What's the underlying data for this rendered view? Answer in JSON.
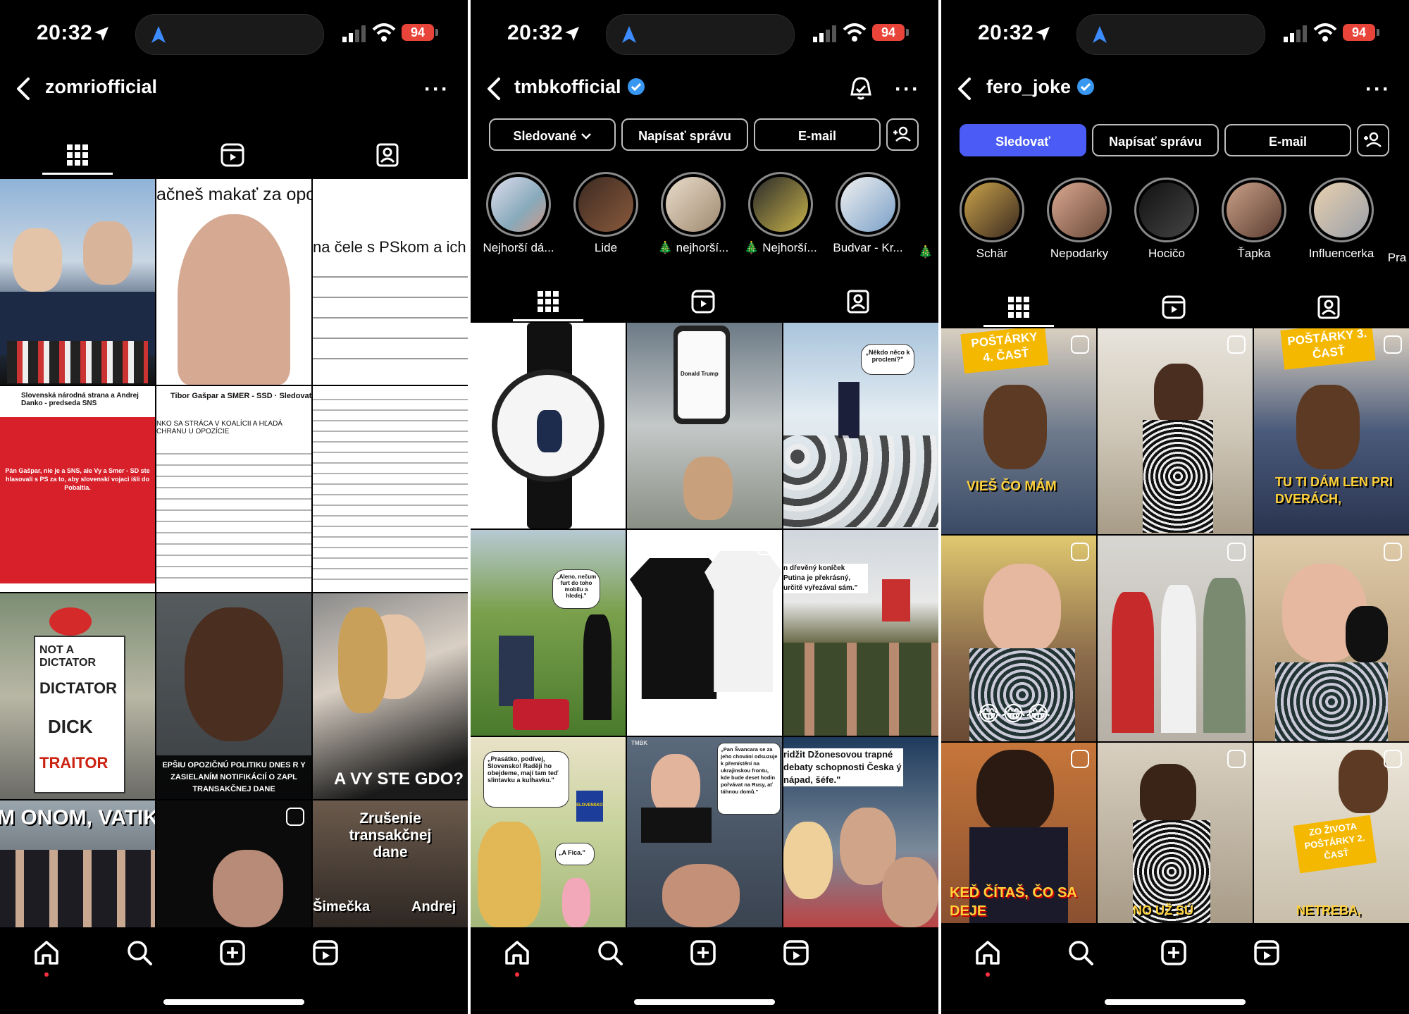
{
  "status": {
    "time": "20:32",
    "battery": "94"
  },
  "phones": [
    {
      "username": "zomriofficial",
      "verified": false,
      "grid_texts": [
        "ačneš makať za opo",
        "na čele s PSkom a ich",
        "Slovenská národná strana a Andrej Danko - predseda SNS",
        "Pán Gašpar, nie je a SNS, ale Vy a Smer - SD ste hlasovali s PS za to, aby slovenskí vojaci išli do Pobaltia.",
        "Tibor Gašpar a SMER - SSD · Sledovať",
        "NKO SA STRÁCA V KOALÍCII A HĽADÁ CHRANU U OPOZÍCIE",
        "NOT A DICTATOR",
        "DICTATOR",
        "DICK",
        "TRAITOR",
        "EPŠIU OPOZIČNÚ POLITIKU DNES R Y ZASIELANÍM NOTIFIKÁCIÍ O ZAPL TRANSAKČNEJ DANE",
        "A VY STE GDO?",
        "M ONOM, VATIK",
        "Zrušenie transakčnej dane",
        "Šimečka",
        "Andrej"
      ]
    },
    {
      "username": "tmbkofficial",
      "verified": true,
      "buttons": [
        "Sledované",
        "Napísať správu",
        "E-mail"
      ],
      "stories": [
        "Nejhorší dá...",
        "Lide",
        "🎄 nejhorší...",
        "🎄 Nejhorší...",
        "Budvar - Kr...",
        "🎄"
      ],
      "grid_texts": [
        "„Někdo něco k proclení?\"",
        "Donald Trump",
        "„Aleno, nečum furt do toho mobilu a hledej.\"",
        "n dřevěný koníček Putina je překrásný, určitě vyřezával sám.\"",
        "„Prasátko, podívej, Slovensko! Raději ho obejdeme, mají tam teď slintavku a kulhavku.\"",
        "„A Fica.\"",
        "„Pan Švancara se za jeho chování odsuzuje k přemístění na ukrajinskou frontu, kde bude deset hodin pořvávat na Rusy, ať táhnou domů.\"",
        "ridžit Džonesovou trapné debaty schopnosti Česka ý nápad, šéfe.\"",
        "TMBK",
        "SLOVENSKO"
      ]
    },
    {
      "username": "fero_joke",
      "verified": true,
      "buttons": [
        "Sledovať",
        "Napísať správu",
        "E-mail"
      ],
      "stories": [
        "Schär",
        "Nepodarky",
        "Hocičo",
        "Ťapka",
        "Influencerka",
        "Pra"
      ],
      "grid_texts": [
        "POŠTÁRKY 4. ČASŤ",
        "VIEŠ ČO MÁM",
        "POŠTÁRKY 3. ČASŤ",
        "TU TI DÁM LEN PRI DVERÁCH,",
        "😂😂😂",
        "KEĎ ČÍTAŠ, ČO SA DEJE",
        "NO UŽ SÚ",
        "ZO ŽIVOTA POŠTÁRKY 2. ČASŤ",
        "NETREBA,"
      ]
    }
  ],
  "colors": {
    "accent_blue": "#4a5cf5",
    "verified_blue": "#3897f0",
    "notification_red": "#ff3040",
    "battery_red": "#e8443a"
  },
  "icons": [
    "back-arrow-icon",
    "more-icon",
    "bell-icon",
    "grid-icon",
    "reels-icon",
    "tagged-icon",
    "home-icon",
    "search-icon",
    "create-icon",
    "reels-nav-icon",
    "add-person-icon",
    "chevron-down-icon"
  ]
}
